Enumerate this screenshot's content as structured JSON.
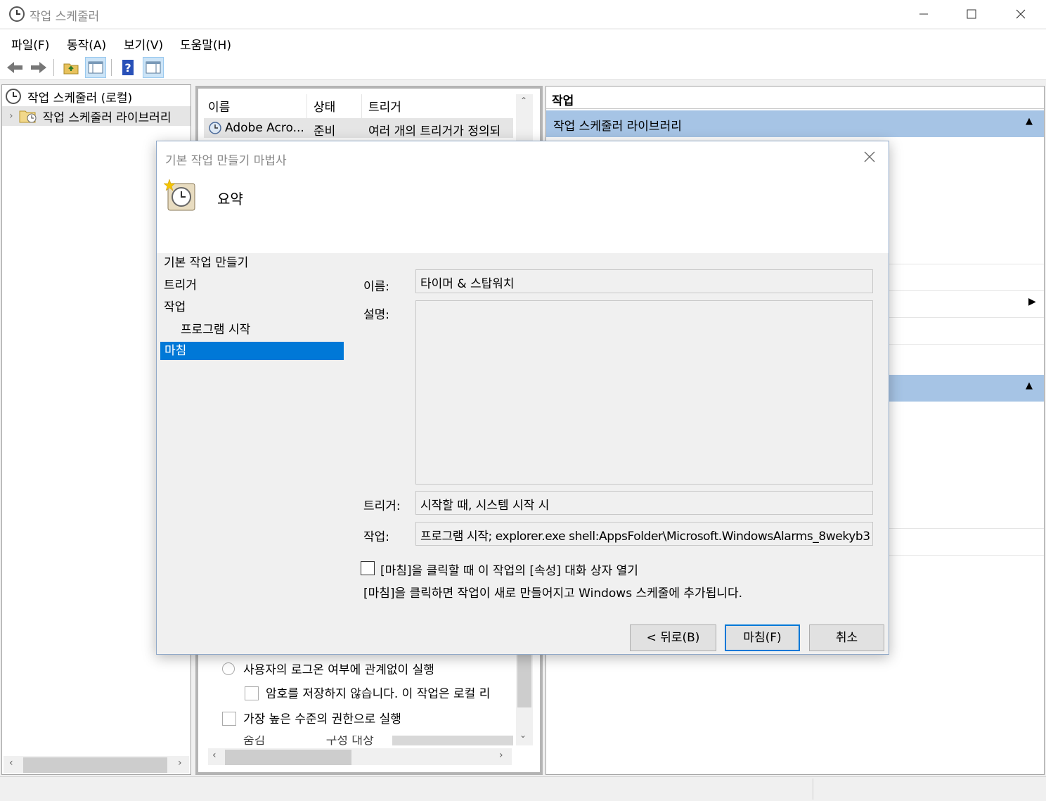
{
  "window": {
    "title": "작업 스케줄러"
  },
  "menu": [
    "파일(F)",
    "동작(A)",
    "보기(V)",
    "도움말(H)"
  ],
  "tree": {
    "root": "작업 스케줄러 (로컬)",
    "library": "작업 스케줄러 라이브러리"
  },
  "task_list": {
    "columns": [
      "이름",
      "상태",
      "트리거"
    ],
    "row": {
      "name": "Adobe Acro...",
      "status": "준비",
      "trigger": "여러 개의 트리거가 정의되"
    }
  },
  "general_tab": {
    "radio_run_whether": "사용자의 로그온 여부에 관계없이 실행",
    "check_no_password": "암호를 저장하지 않습니다. 이 작업은 로컬 리",
    "check_highest": "가장 높은 수준의 권한으로 실행",
    "partial_hidden": "숨김                구성 대상"
  },
  "actions_pane": {
    "title": "작업",
    "section": "작업 스케줄러 라이브러리"
  },
  "dialog": {
    "title": "기본 작업 만들기 마법사",
    "heading": "요약",
    "steps": [
      "기본 작업 만들기",
      "트리거",
      "작업",
      "프로그램 시작",
      "마침"
    ],
    "name_label": "이름:",
    "name_value": "타이머 & 스탑워치",
    "desc_label": "설명:",
    "desc_value": "",
    "trigger_label": "트리거:",
    "trigger_value": "시작할 때, 시스템 시작 시",
    "action_label": "작업:",
    "action_value": "프로그램 시작; explorer.exe shell:AppsFolder\\Microsoft.WindowsAlarms_8wekyb3",
    "open_props_label": "[마침]을 클릭할 때 이 작업의 [속성] 대화 상자 열기",
    "open_props_checked": false,
    "info_text": "[마침]을 클릭하면 작업이 새로 만들어지고 Windows 스케줄에 추가됩니다.",
    "back_button": "< 뒤로(B)",
    "finish_button": "마침(F)",
    "cancel_button": "취소"
  },
  "colors": {
    "accent": "#0078d7",
    "section": "#a6c4e5"
  }
}
